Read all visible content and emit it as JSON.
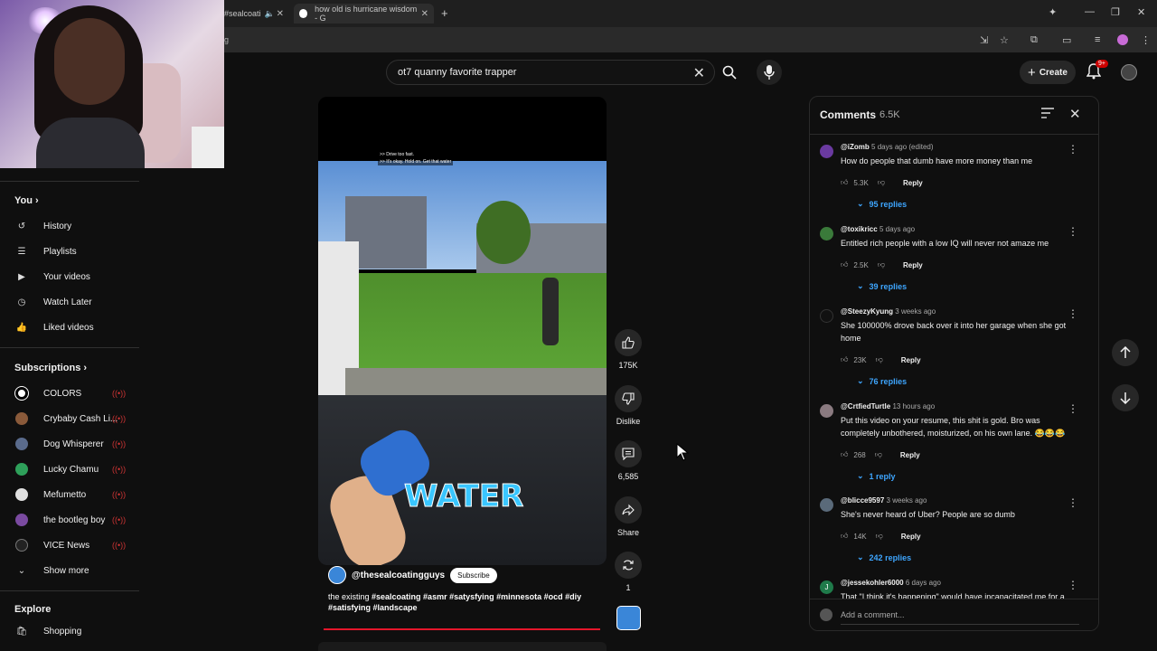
{
  "browser": {
    "tabs": [
      {
        "label": "#sealcoati"
      },
      {
        "label": "how old is hurricane wisdom - G"
      }
    ],
    "url": "g"
  },
  "masthead": {
    "search_query": "ot7 quanny favorite trapper",
    "create_label": "Create",
    "notifications_badge": "9+"
  },
  "sidebar": {
    "you_label": "You",
    "you_items": [
      {
        "label": "History",
        "icon": "history-icon"
      },
      {
        "label": "Playlists",
        "icon": "playlists-icon"
      },
      {
        "label": "Your videos",
        "icon": "your-videos-icon"
      },
      {
        "label": "Watch Later",
        "icon": "watch-later-icon"
      },
      {
        "label": "Liked videos",
        "icon": "liked-videos-icon"
      }
    ],
    "subscriptions_label": "Subscriptions",
    "subscriptions": [
      {
        "label": "COLORS",
        "color": "#ffffff"
      },
      {
        "label": "Crybaby Cash Li...",
        "color": "#8a5a3a"
      },
      {
        "label": "Dog Whisperer",
        "color": "#5a6b8c"
      },
      {
        "label": "Lucky Chamu",
        "color": "#2ea05a"
      },
      {
        "label": "Mefumetto",
        "color": "#e0e0e0"
      },
      {
        "label": "the bootleg boy",
        "color": "#7a4aa0"
      },
      {
        "label": "VICE News",
        "color": "#222222"
      }
    ],
    "show_more_label": "Show more",
    "explore_label": "Explore",
    "explore_items": [
      {
        "label": "Shopping",
        "icon": "shopping-icon"
      }
    ]
  },
  "short": {
    "caption_line1": ">> Drive too fast.",
    "caption_line2": ">> It's okay. Hold on. Get that water",
    "overlay_text": "WATER",
    "channel": "@thesealcoatingguys",
    "subscribe_label": "Subscribe",
    "description_prefix": "the existing ",
    "hashtags_line1": "#sealcoating #asmr #satysfying #minnesota #ocd #diy",
    "hashtags_line2": "#satisfying #landscape",
    "likes": "175K",
    "dislike_label": "Dislike",
    "comments_count": "6,585",
    "share_label": "Share",
    "remix_count": "1"
  },
  "comments": {
    "title": "Comments",
    "count": "6.5K",
    "add_placeholder": "Add a comment...",
    "reply_label": "Reply",
    "items": [
      {
        "handle": "@iZomb",
        "time": "5 days ago (edited)",
        "text": "How do people that dumb have more money than me",
        "likes": "5.3K",
        "replies": "95 replies",
        "avatar_color": "#6a3aa0"
      },
      {
        "handle": "@toxikricc",
        "time": "5 days ago",
        "text": "Entitled rich people with a low IQ will never not amaze me",
        "likes": "2.5K",
        "replies": "39 replies",
        "avatar_color": "#3a7a3a"
      },
      {
        "handle": "@SteezyKyung",
        "time": "3 weeks ago",
        "text": "She 100000% drove back over it into her garage when she got home",
        "likes": "23K",
        "replies": "76 replies",
        "avatar_color": "#111111"
      },
      {
        "handle": "@CrtfiedTurtle",
        "time": "13 hours ago",
        "text": "Put this video on your resume, this shit is gold. Bro was completely unbothered, moisturized, on his own lane. 😂😂😂",
        "likes": "268",
        "replies": "1 reply",
        "avatar_color": "#8a7a80"
      },
      {
        "handle": "@blicce9597",
        "time": "3 weeks ago",
        "text": "She's never heard of Uber? People are so dumb",
        "likes": "14K",
        "replies": "242 replies",
        "avatar_color": "#5a6a7a"
      },
      {
        "handle": "@jessekohler6000",
        "time": "6 days ago",
        "text": "That \"I think it's happening\" would have incapacitated me for a",
        "likes": "",
        "replies": "",
        "avatar_color": "#1f7a4a",
        "initial": "J"
      }
    ]
  }
}
